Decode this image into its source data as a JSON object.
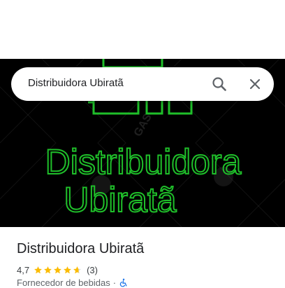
{
  "search": {
    "query": "Distribuidora Ubiratã"
  },
  "hero": {
    "logo_line1": "Distribuidora",
    "logo_line2": "Ubiratã",
    "watermark": "GAS",
    "logo_color": "#1fbf2a"
  },
  "place": {
    "name": "Distribuidora Ubiratã",
    "rating": "4,7",
    "rating_stars": 4.7,
    "review_count": "(3)",
    "category": "Fornecedor de bebidas",
    "separator": "·"
  },
  "colors": {
    "star": "#fbbc04",
    "accessibility_icon": "#1a73e8"
  },
  "icons": {
    "search": "search-icon",
    "close": "close-icon",
    "accessibility": "wheelchair-icon"
  }
}
